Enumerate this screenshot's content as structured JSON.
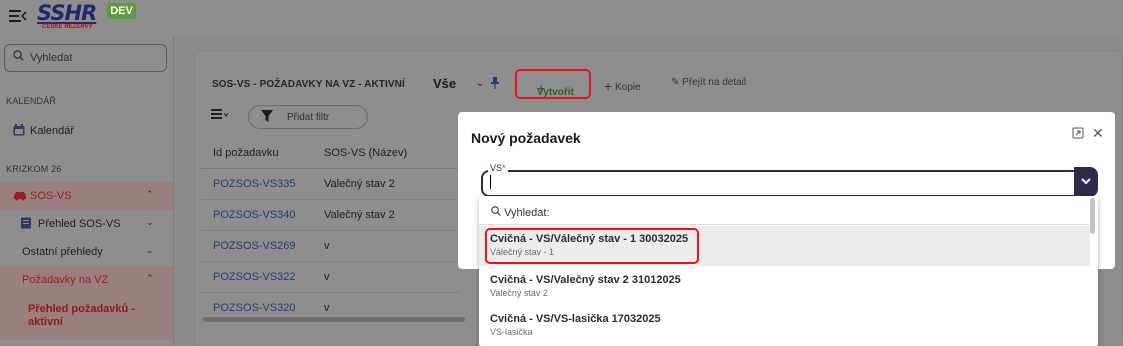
{
  "header": {
    "logo_text": "SSHR",
    "logo_subtitle": "ČESKÉ REZERVY",
    "env_badge": "DEV"
  },
  "sidebar": {
    "search_placeholder": "Vyhledat",
    "section_calendar": "KALENDÁŘ",
    "calendar_item": "Kalendář",
    "section_krizkom": "KRIZKOM 26",
    "sosvs_item": "SOS-VS",
    "prehled_sosvs": "Přehled SOS-VS",
    "ostatni_prehledy": "Ostatní přehledy",
    "pozadavky_na_vz": "Požadavky na VZ",
    "prehled_pozadavku": "Přehled požadavků - aktivní"
  },
  "toolbar": {
    "title": "SOS-VS - POŽADAVKY NA VZ - AKTIVNÍ",
    "view_select": "Vše",
    "create_label": "Vytvořit",
    "copy_label": "Kopie",
    "detail_label": "Přejít na detail",
    "add_filter": "Přidat filtr"
  },
  "table": {
    "columns": [
      "Id požadavku",
      "SOS-VS (Název)"
    ],
    "rows": [
      {
        "id": "POZSOS-VS335",
        "name": "Valečný stav 2"
      },
      {
        "id": "POZSOS-VS340",
        "name": "Valečný stav 2"
      },
      {
        "id": "POZSOS-VS269",
        "name": "v"
      },
      {
        "id": "POZSOS-VS322",
        "name": "v"
      },
      {
        "id": "POZSOS-VS320",
        "name": "v"
      }
    ]
  },
  "modal": {
    "title": "Nový požadavek",
    "field_label": "VS",
    "field_required": "*",
    "field_value": ""
  },
  "dropdown": {
    "search_placeholder": "Vyhledat:",
    "options": [
      {
        "main": "Cvičná - VS/Válečný stav - 1 30032025",
        "sub": "Válečný stav - 1"
      },
      {
        "main": "Cvičná - VS/Valečný stav 2 31012025",
        "sub": "Valečný stav 2"
      },
      {
        "main": "Cvičná - VS/VS-lasička 17032025",
        "sub": "VS-lasička"
      }
    ]
  }
}
